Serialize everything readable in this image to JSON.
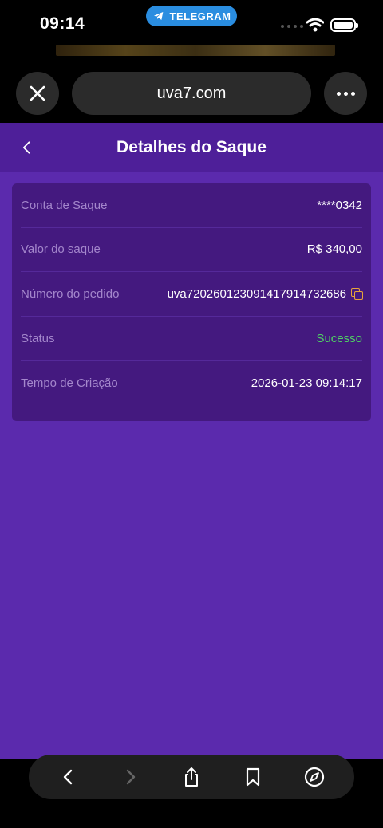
{
  "status_bar": {
    "time": "09:14",
    "source_app": "TELEGRAM"
  },
  "browser": {
    "url": "uva7.com"
  },
  "page": {
    "title": "Detalhes do Saque",
    "rows": [
      {
        "label": "Conta de Saque",
        "value": "****0342"
      },
      {
        "label": "Valor do saque",
        "value": "R$ 340,00"
      },
      {
        "label": "Número do pedido",
        "value": "uva72026012309141791473268​6"
      },
      {
        "label": "Status",
        "value": "Sucesso"
      },
      {
        "label": "Tempo de Criação",
        "value": "2026-01-23 09:14:17"
      }
    ]
  },
  "colors": {
    "page_bg": "#5b2aad",
    "card_bg": "#44197f",
    "success": "#4fd364",
    "label": "#a487cc",
    "copy_icon": "#e8a33a"
  }
}
